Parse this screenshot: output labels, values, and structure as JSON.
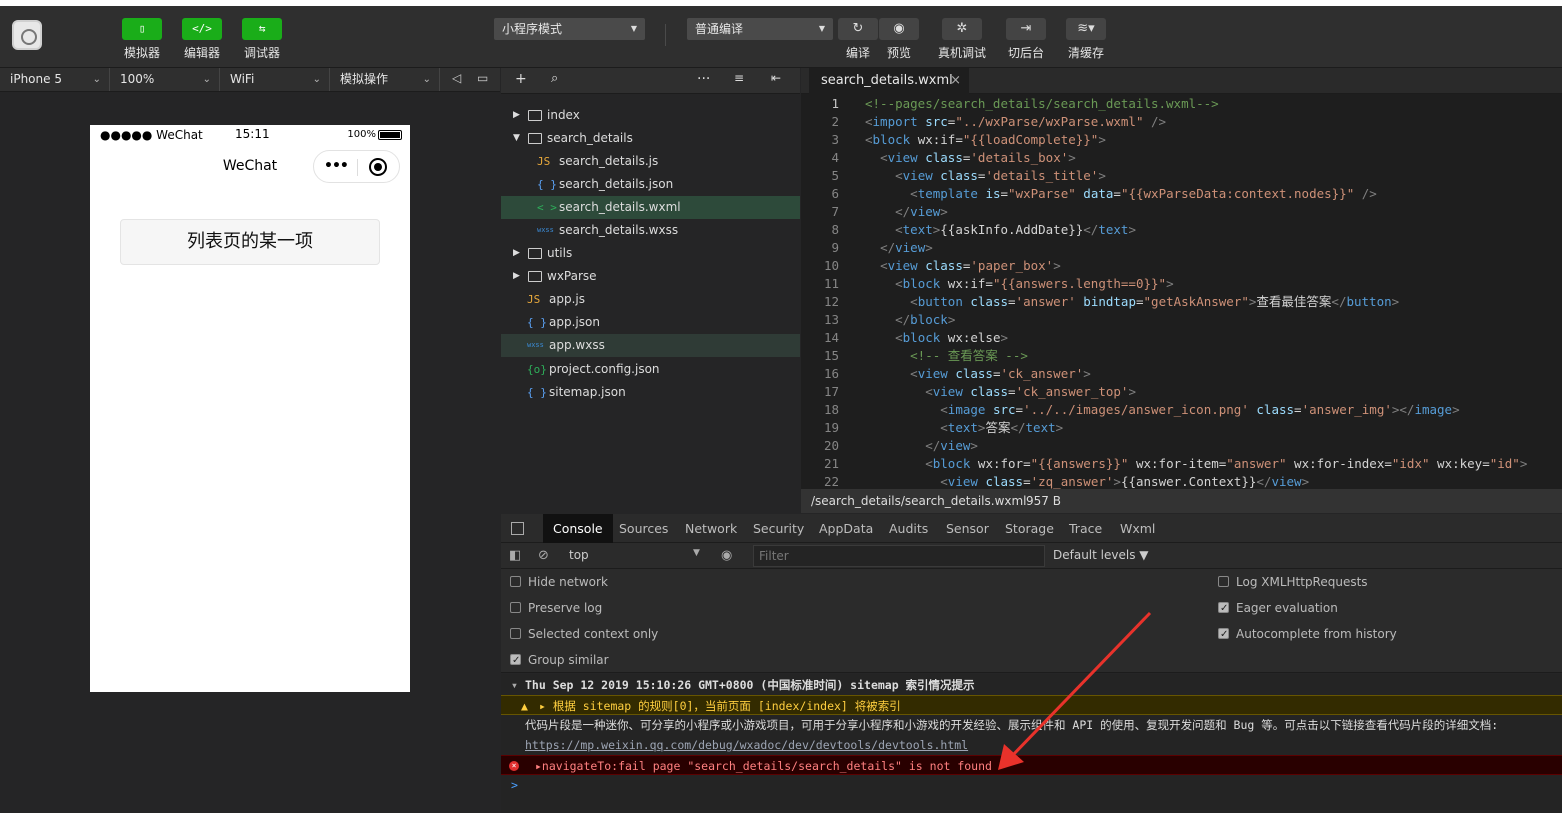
{
  "toolbar": {
    "left_buttons": [
      {
        "label": "模拟器",
        "icon": "phone-icon"
      },
      {
        "label": "编辑器",
        "icon": "code-icon"
      },
      {
        "label": "调试器",
        "icon": "debug-arrows-icon"
      }
    ],
    "mode_select": "小程序模式",
    "compile_select": "普通编译",
    "right_buttons": [
      {
        "label": "编译",
        "icon": "refresh-icon"
      },
      {
        "label": "预览",
        "icon": "eye-icon"
      },
      {
        "label": "真机调试",
        "icon": "bug-icon"
      },
      {
        "label": "切后台",
        "icon": "background-icon"
      },
      {
        "label": "清缓存",
        "icon": "layers-icon"
      }
    ]
  },
  "simulator": {
    "device": "iPhone 5",
    "zoom": "100%",
    "network": "WiFi",
    "operation": "模拟操作",
    "status_left": "●●●●● WeChat",
    "status_time": "15:11",
    "status_battery": "100%",
    "nav_title": "WeChat",
    "capsule_dots": "•••",
    "list_item": "列表页的某一项"
  },
  "filetree": {
    "nodes": [
      {
        "name": "index",
        "type": "folder",
        "expanded": false
      },
      {
        "name": "search_details",
        "type": "folder",
        "expanded": true
      },
      {
        "name": "search_details.js",
        "type": "js",
        "icon_text": "JS"
      },
      {
        "name": "search_details.json",
        "type": "json",
        "icon_text": "{ }"
      },
      {
        "name": "search_details.wxml",
        "type": "wxml",
        "icon_text": "< >"
      },
      {
        "name": "search_details.wxss",
        "type": "wxss",
        "icon_text": "wxss"
      },
      {
        "name": "utils",
        "type": "folder",
        "expanded": false
      },
      {
        "name": "wxParse",
        "type": "folder",
        "expanded": false
      },
      {
        "name": "app.js",
        "type": "js",
        "icon_text": "JS"
      },
      {
        "name": "app.json",
        "type": "json",
        "icon_text": "{ }"
      },
      {
        "name": "app.wxss",
        "type": "wxss",
        "icon_text": "wxss"
      },
      {
        "name": "project.config.json",
        "type": "config",
        "icon_text": "{o}"
      },
      {
        "name": "sitemap.json",
        "type": "json",
        "icon_text": "{ }"
      }
    ]
  },
  "editor": {
    "tab_name": "search_details.wxml",
    "tab_close": "×",
    "file_path": "/search_details/search_details.wxml",
    "file_size": "957 B",
    "lines": [
      {
        "n": "1",
        "segs": [
          [
            "c",
            "<!--pages/search_details/search_details.wxml-->"
          ]
        ]
      },
      {
        "n": "2",
        "segs": [
          [
            "p",
            "<"
          ],
          [
            "t",
            "import"
          ],
          [
            "x",
            " "
          ],
          [
            "a",
            "src"
          ],
          [
            "x",
            "="
          ],
          [
            "s",
            "\"../wxParse/wxParse.wxml\""
          ],
          [
            "x",
            " "
          ],
          [
            "p",
            "/>"
          ]
        ]
      },
      {
        "n": "3",
        "segs": [
          [
            "p",
            "<"
          ],
          [
            "t",
            "block"
          ],
          [
            "x",
            " wx:if="
          ],
          [
            "s",
            "\"{{loadComplete}}\""
          ],
          [
            "p",
            ">"
          ]
        ]
      },
      {
        "n": "4",
        "segs": [
          [
            "x",
            "  "
          ],
          [
            "p",
            "<"
          ],
          [
            "t",
            "view"
          ],
          [
            "x",
            " "
          ],
          [
            "a",
            "class"
          ],
          [
            "x",
            "="
          ],
          [
            "s",
            "'details_box'"
          ],
          [
            "p",
            ">"
          ]
        ]
      },
      {
        "n": "5",
        "segs": [
          [
            "x",
            "    "
          ],
          [
            "p",
            "<"
          ],
          [
            "t",
            "view"
          ],
          [
            "x",
            " "
          ],
          [
            "a",
            "class"
          ],
          [
            "x",
            "="
          ],
          [
            "s",
            "'details_title'"
          ],
          [
            "p",
            ">"
          ]
        ]
      },
      {
        "n": "6",
        "segs": [
          [
            "x",
            "      "
          ],
          [
            "p",
            "<"
          ],
          [
            "t",
            "template"
          ],
          [
            "x",
            " "
          ],
          [
            "a",
            "is"
          ],
          [
            "x",
            "="
          ],
          [
            "s",
            "\"wxParse\""
          ],
          [
            "x",
            " "
          ],
          [
            "a",
            "data"
          ],
          [
            "x",
            "="
          ],
          [
            "s",
            "\"{{wxParseData:context.nodes}}\""
          ],
          [
            "x",
            " "
          ],
          [
            "p",
            "/>"
          ]
        ]
      },
      {
        "n": "7",
        "segs": [
          [
            "x",
            "    "
          ],
          [
            "p",
            "</"
          ],
          [
            "t",
            "view"
          ],
          [
            "p",
            ">"
          ]
        ]
      },
      {
        "n": "8",
        "segs": [
          [
            "x",
            "    "
          ],
          [
            "p",
            "<"
          ],
          [
            "t",
            "text"
          ],
          [
            "p",
            ">"
          ],
          [
            "x",
            "{{askInfo.AddDate}}"
          ],
          [
            "p",
            "</"
          ],
          [
            "t",
            "text"
          ],
          [
            "p",
            ">"
          ]
        ]
      },
      {
        "n": "9",
        "segs": [
          [
            "x",
            "  "
          ],
          [
            "p",
            "</"
          ],
          [
            "t",
            "view"
          ],
          [
            "p",
            ">"
          ]
        ]
      },
      {
        "n": "10",
        "segs": [
          [
            "x",
            "  "
          ],
          [
            "p",
            "<"
          ],
          [
            "t",
            "view"
          ],
          [
            "x",
            " "
          ],
          [
            "a",
            "class"
          ],
          [
            "x",
            "="
          ],
          [
            "s",
            "'paper_box'"
          ],
          [
            "p",
            ">"
          ]
        ]
      },
      {
        "n": "11",
        "segs": [
          [
            "x",
            "    "
          ],
          [
            "p",
            "<"
          ],
          [
            "t",
            "block"
          ],
          [
            "x",
            " wx:if="
          ],
          [
            "s",
            "\"{{answers.length==0}}\""
          ],
          [
            "p",
            ">"
          ]
        ]
      },
      {
        "n": "12",
        "segs": [
          [
            "x",
            "      "
          ],
          [
            "p",
            "<"
          ],
          [
            "t",
            "button"
          ],
          [
            "x",
            " "
          ],
          [
            "a",
            "class"
          ],
          [
            "x",
            "="
          ],
          [
            "s",
            "'answer'"
          ],
          [
            "x",
            " "
          ],
          [
            "a",
            "bindtap"
          ],
          [
            "x",
            "="
          ],
          [
            "s",
            "\"getAskAnswer\""
          ],
          [
            "p",
            ">"
          ],
          [
            "x",
            "查看最佳答案"
          ],
          [
            "p",
            "</"
          ],
          [
            "t",
            "button"
          ],
          [
            "p",
            ">"
          ]
        ]
      },
      {
        "n": "13",
        "segs": [
          [
            "x",
            "    "
          ],
          [
            "p",
            "</"
          ],
          [
            "t",
            "block"
          ],
          [
            "p",
            ">"
          ]
        ]
      },
      {
        "n": "14",
        "segs": [
          [
            "x",
            "    "
          ],
          [
            "p",
            "<"
          ],
          [
            "t",
            "block"
          ],
          [
            "x",
            " wx:else"
          ],
          [
            "p",
            ">"
          ]
        ]
      },
      {
        "n": "15",
        "segs": [
          [
            "x",
            "      "
          ],
          [
            "c",
            "<!-- 查看答案 -->"
          ]
        ]
      },
      {
        "n": "16",
        "segs": [
          [
            "x",
            "      "
          ],
          [
            "p",
            "<"
          ],
          [
            "t",
            "view"
          ],
          [
            "x",
            " "
          ],
          [
            "a",
            "class"
          ],
          [
            "x",
            "="
          ],
          [
            "s",
            "'ck_answer'"
          ],
          [
            "p",
            ">"
          ]
        ]
      },
      {
        "n": "17",
        "segs": [
          [
            "x",
            "        "
          ],
          [
            "p",
            "<"
          ],
          [
            "t",
            "view"
          ],
          [
            "x",
            " "
          ],
          [
            "a",
            "class"
          ],
          [
            "x",
            "="
          ],
          [
            "s",
            "'ck_answer_top'"
          ],
          [
            "p",
            ">"
          ]
        ]
      },
      {
        "n": "18",
        "segs": [
          [
            "x",
            "          "
          ],
          [
            "p",
            "<"
          ],
          [
            "t",
            "image"
          ],
          [
            "x",
            " "
          ],
          [
            "a",
            "src"
          ],
          [
            "x",
            "="
          ],
          [
            "s",
            "'../../images/answer_icon.png'"
          ],
          [
            "x",
            " "
          ],
          [
            "a",
            "class"
          ],
          [
            "x",
            "="
          ],
          [
            "s",
            "'answer_img'"
          ],
          [
            "p",
            "></"
          ],
          [
            "t",
            "image"
          ],
          [
            "p",
            ">"
          ]
        ]
      },
      {
        "n": "19",
        "segs": [
          [
            "x",
            "          "
          ],
          [
            "p",
            "<"
          ],
          [
            "t",
            "text"
          ],
          [
            "p",
            ">"
          ],
          [
            "x",
            "答案"
          ],
          [
            "p",
            "</"
          ],
          [
            "t",
            "text"
          ],
          [
            "p",
            ">"
          ]
        ]
      },
      {
        "n": "20",
        "segs": [
          [
            "x",
            "        "
          ],
          [
            "p",
            "</"
          ],
          [
            "t",
            "view"
          ],
          [
            "p",
            ">"
          ]
        ]
      },
      {
        "n": "21",
        "segs": [
          [
            "x",
            "        "
          ],
          [
            "p",
            "<"
          ],
          [
            "t",
            "block"
          ],
          [
            "x",
            " wx:for="
          ],
          [
            "s",
            "\"{{answers}}\""
          ],
          [
            "x",
            " wx:for-item="
          ],
          [
            "s",
            "\"answer\""
          ],
          [
            "x",
            " wx:for-index="
          ],
          [
            "s",
            "\"idx\""
          ],
          [
            "x",
            " wx:key="
          ],
          [
            "s",
            "\"id\""
          ],
          [
            "p",
            ">"
          ]
        ]
      },
      {
        "n": "22",
        "segs": [
          [
            "x",
            "          "
          ],
          [
            "p",
            "<"
          ],
          [
            "t",
            "view"
          ],
          [
            "x",
            " "
          ],
          [
            "a",
            "class"
          ],
          [
            "x",
            "="
          ],
          [
            "s",
            "'zq_answer'"
          ],
          [
            "p",
            ">"
          ],
          [
            "x",
            "{{answer.Context}}"
          ],
          [
            "p",
            "</"
          ],
          [
            "t",
            "view"
          ],
          [
            "p",
            ">"
          ]
        ]
      }
    ]
  },
  "devtools": {
    "tabs": [
      "Console",
      "Sources",
      "Network",
      "Security",
      "AppData",
      "Audits",
      "Sensor",
      "Storage",
      "Trace",
      "Wxml"
    ],
    "active_tab": "Console",
    "context": "top",
    "filter_placeholder": "Filter",
    "levels": "Default levels ▼",
    "options_left": [
      {
        "label": "Hide network",
        "checked": false
      },
      {
        "label": "Preserve log",
        "checked": false
      },
      {
        "label": "Selected context only",
        "checked": false
      },
      {
        "label": "Group similar",
        "checked": true
      }
    ],
    "options_right": [
      {
        "label": "Log XMLHttpRequests",
        "checked": false
      },
      {
        "label": "Eager evaluation",
        "checked": true
      },
      {
        "label": "Autocomplete from history",
        "checked": true
      }
    ],
    "console": {
      "group_header": "Thu Sep 12 2019 15:10:26 GMT+0800 (中国标准时间) sitemap 索引情况提示",
      "warning": "▸ 根据 sitemap 的规则[0]，当前页面 [index/index] 将被索引",
      "info": "代码片段是一种迷你、可分享的小程序或小游戏项目，可用于分享小程序和小游戏的开发经验、展示组件和 API 的使用、复现开发问题和 Bug 等。可点击以下链接查看代码片段的详细文档:",
      "link": "https://mp.weixin.qq.com/debug/wxadoc/dev/devtools/devtools.html",
      "error": "▸navigateTo:fail page \"search_details/search_details\" is not found",
      "prompt": ">"
    }
  },
  "annotation": {
    "arrow_color": "#e8322b"
  }
}
